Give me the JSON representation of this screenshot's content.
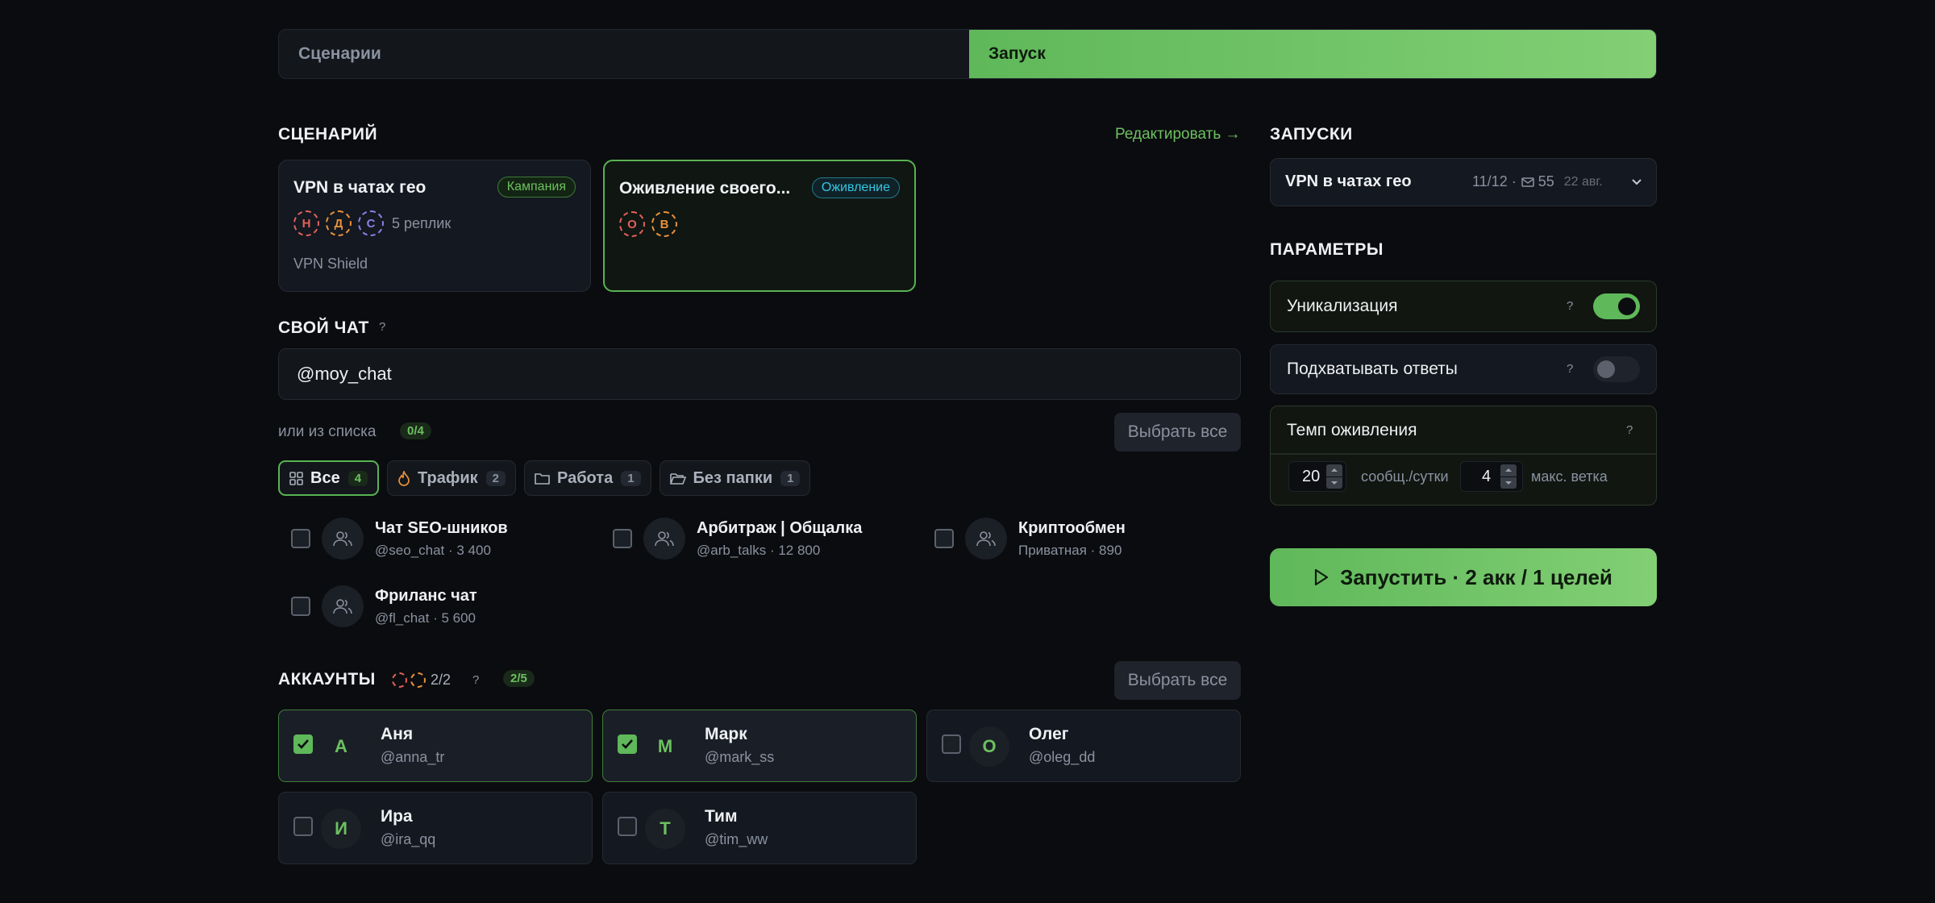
{
  "tabs": {
    "scenarios": "Сценарии",
    "launch": "Запуск"
  },
  "scenario": {
    "title": "СЦЕНАРИЙ",
    "edit_link": "Редактировать →",
    "cards": [
      {
        "title": "VPN в чатах гео",
        "badge": "Кампания",
        "avatars": [
          "Н",
          "Д",
          "С"
        ],
        "replies": "5 реплик",
        "subtitle": "VPN Shield"
      },
      {
        "title": "Оживление своего...",
        "badge": "Оживление",
        "avatars": [
          "О",
          "В"
        ]
      }
    ]
  },
  "own_chat": {
    "title": "СВОЙ ЧАТ",
    "help": "?",
    "value": "@moy_chat",
    "or_list": "или из списка",
    "selected_count": "0/4",
    "select_all": "Выбрать все"
  },
  "filters": [
    {
      "label": "Все",
      "count": "4",
      "icon": "grid-icon"
    },
    {
      "label": "Трафик",
      "count": "2",
      "icon": "flame-icon"
    },
    {
      "label": "Работа",
      "count": "1",
      "icon": "folder-icon"
    },
    {
      "label": "Без папки",
      "count": "1",
      "icon": "folder-open-icon"
    }
  ],
  "chats": [
    {
      "name": "Чат SEO-шников",
      "meta": "@seo_chat · 3 400"
    },
    {
      "name": "Арбитраж | Общалка",
      "meta": "@arb_talks · 12 800"
    },
    {
      "name": "Криптообмен",
      "meta": "Приватная · 890"
    },
    {
      "name": "Фриланс чат",
      "meta": "@fl_chat · 5 600"
    }
  ],
  "accounts": {
    "title": "АККАУНТЫ",
    "online": "2/2",
    "help": "?",
    "selected_count": "2/5",
    "select_all": "Выбрать все",
    "items": [
      {
        "initial": "А",
        "name": "Аня",
        "username": "@anna_tr",
        "checked": true
      },
      {
        "initial": "М",
        "name": "Марк",
        "username": "@mark_ss",
        "checked": true
      },
      {
        "initial": "О",
        "name": "Олег",
        "username": "@oleg_dd",
        "checked": false
      },
      {
        "initial": "И",
        "name": "Ира",
        "username": "@ira_qq",
        "checked": false
      },
      {
        "initial": "Т",
        "name": "Тим",
        "username": "@tim_ww",
        "checked": false
      }
    ]
  },
  "runs": {
    "title": "ЗАПУСКИ",
    "selected": {
      "name": "VPN в чатах гео",
      "progress": "11/12 ·",
      "messages": "55",
      "date": "22 авг."
    }
  },
  "params": {
    "title": "ПАРАМЕТРЫ",
    "uniq": {
      "label": "Уникализация",
      "help": "?",
      "on": true
    },
    "pickup": {
      "label": "Подхватывать ответы",
      "help": "?",
      "on": false
    },
    "pace": {
      "label": "Темп оживления",
      "help": "?",
      "per_day_value": "20",
      "per_day_unit": "сообщ./сутки",
      "branch_value": "4",
      "branch_unit": "макс. ветка"
    }
  },
  "launch_button": "Запустить · 2 акк / 1 целей",
  "colors": {
    "accent": "#5fb85a",
    "accent_light": "#82cf74",
    "background": "#0b0c0f",
    "card": "#141820",
    "cyan": "#35c6e4"
  }
}
